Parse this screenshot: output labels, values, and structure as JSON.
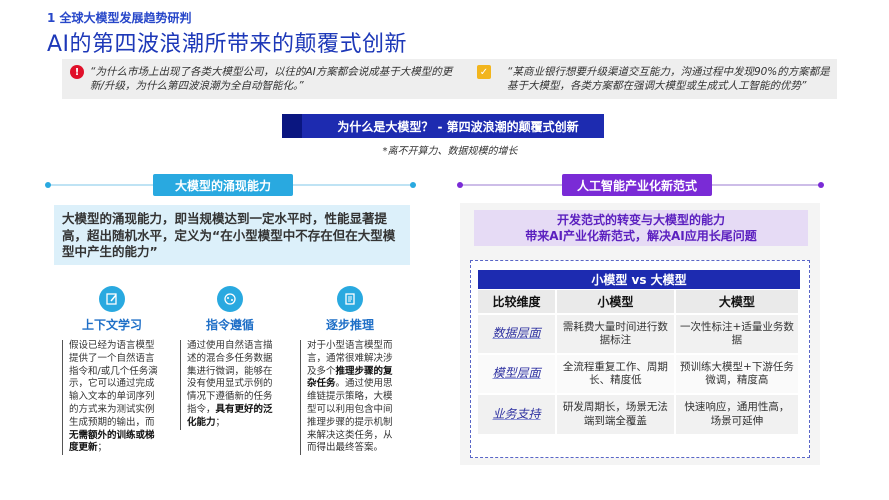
{
  "header": {
    "section_label": "1 全球大模型发展趋势研判",
    "title": "AI的第四波浪潮所带来的颠覆式创新"
  },
  "quotes": {
    "left": "“为什么市场上出现了各类大模型公司，以往的AI方案都会说成基于大模型的更新/升级，为什么第四波浪潮为全自动智能化。”",
    "right": "“某商业银行想要升级渠道交互能力，沟通过程中发现90%的方案都是基于大模型，各类方案都在强调大模型或生成式人工智能的优势”"
  },
  "banner": {
    "title": "为什么是大模型？ - 第四波浪潮的颠覆式创新",
    "note": "*离不开算力、数据规模的增长"
  },
  "left_section": {
    "title": "大模型的涌现能力",
    "emergence_text": "大模型的涌现能力，即当规模达到一定水平时，性能显著提高，超出随机水平，定义为“在小型模型中不存在但在大型模型中产生的能力”",
    "abilities": [
      {
        "title": "上下文学习",
        "icon": "edit-icon",
        "body_pre": "假设已经为语言模型提供了一个自然语言指令和/或几个任务演示，它可以通过完成输入文本的单词序列的方式来为测试实例生成预期的输出，而",
        "body_bold": "无需额外的训练或梯度更新",
        "body_post": "；"
      },
      {
        "title": "指令遵循",
        "icon": "brain-icon",
        "body_pre": "通过使用自然语言描述的混合多任务数据集进行微调，能够在没有使用显式示例的情况下遵循新的任务指令，",
        "body_bold": "具有更好的泛化能力",
        "body_post": "；"
      },
      {
        "title": "逐步推理",
        "icon": "document-icon",
        "body_pre": "对于小型语言模型而言，通常很难解决涉及多个",
        "body_bold": "推理步骤的复杂任务",
        "body_post": "。通过使用思维链提示策略，大模型可以利用包含中间推理步骤的提示机制来解决这类任务，从而得出最终答案。"
      }
    ]
  },
  "right_section": {
    "title": "人工智能产业化新范式",
    "head_line1": "开发范式的转变与大模型的能力",
    "head_line2": "带来AI产业化新范式，解决AI应用长尾问题",
    "table": {
      "title": "小模型 vs 大模型",
      "headers": [
        "比较维度",
        "小模型",
        "大模型"
      ],
      "rows": [
        [
          "数据层面",
          "需耗费大量时间进行数据标注",
          "一次性标注+适量业务数据"
        ],
        [
          "模型层面",
          "全流程重复工作、周期长、精度低",
          "预训练大模型+下游任务微调，精度高"
        ],
        [
          "业务支持",
          "研发周期长，场景无法端到端全覆盖",
          "快速响应，通用性高，场景可延伸"
        ]
      ]
    }
  },
  "colors": {
    "primary_blue": "#1d2bb0",
    "cyan": "#29a9e0",
    "purple": "#7a2bd6"
  }
}
